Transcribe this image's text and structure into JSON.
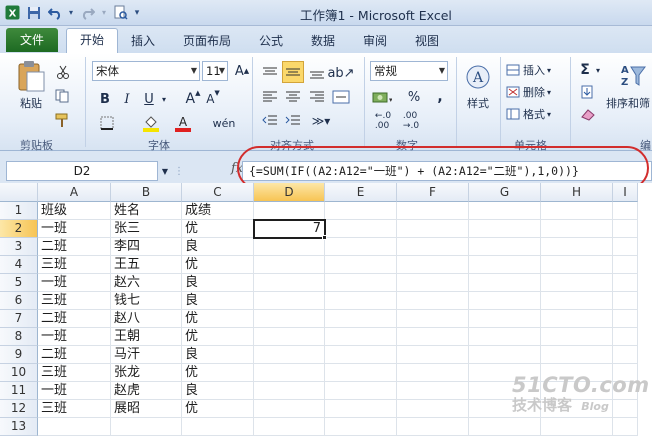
{
  "window": {
    "title": "工作簿1 - Microsoft Excel"
  },
  "qat": {
    "save_icon": "save-icon",
    "undo_icon": "undo-icon",
    "redo_icon": "redo-icon",
    "preview_icon": "print-preview-icon"
  },
  "tabs": [
    {
      "label": "文件"
    },
    {
      "label": "开始"
    },
    {
      "label": "插入"
    },
    {
      "label": "页面布局"
    },
    {
      "label": "公式"
    },
    {
      "label": "数据"
    },
    {
      "label": "审阅"
    },
    {
      "label": "视图"
    }
  ],
  "ribbon": {
    "clipboard": {
      "paste": "粘贴",
      "label": "剪贴板"
    },
    "font": {
      "name": "宋体",
      "size": "11",
      "label": "字体",
      "bold": "B",
      "italic": "I",
      "underline": "U"
    },
    "alignment": {
      "label": "对齐方式"
    },
    "number": {
      "format": "常规",
      "percent": "%",
      "comma": ",",
      "label": "数字"
    },
    "styles": {
      "label": "样式"
    },
    "cells": {
      "insert": "插入",
      "delete": "删除",
      "format": "格式",
      "label": "单元格"
    },
    "editing": {
      "sigma": "Σ",
      "sort": "排序和筛",
      "label": "编"
    }
  },
  "formula_bar": {
    "name_box": "D2",
    "fx": "fx",
    "formula": "{=SUM(IF((A2:A12=\"一班\") + (A2:A12=\"二班\"),1,0))}"
  },
  "sheet": {
    "columns": [
      "A",
      "B",
      "C",
      "D",
      "E",
      "F",
      "G",
      "H",
      "I"
    ],
    "rows": [
      "1",
      "2",
      "3",
      "4",
      "5",
      "6",
      "7",
      "8",
      "9",
      "10",
      "11",
      "12",
      "13"
    ],
    "cells": [
      [
        "班级",
        "姓名",
        "成绩",
        ""
      ],
      [
        "一班",
        "张三",
        "优",
        "7"
      ],
      [
        "二班",
        "李四",
        "良",
        ""
      ],
      [
        "三班",
        "王五",
        "优",
        ""
      ],
      [
        "一班",
        "赵六",
        "良",
        ""
      ],
      [
        "三班",
        "钱七",
        "良",
        ""
      ],
      [
        "二班",
        "赵八",
        "优",
        ""
      ],
      [
        "一班",
        "王朝",
        "优",
        ""
      ],
      [
        "二班",
        "马汗",
        "良",
        ""
      ],
      [
        "三班",
        "张龙",
        "优",
        ""
      ],
      [
        "一班",
        "赵虎",
        "良",
        ""
      ],
      [
        "三班",
        "展昭",
        "优",
        ""
      ],
      [
        "",
        "",
        "",
        ""
      ]
    ],
    "active_cell": "D2"
  },
  "watermark": {
    "line1": "51CTO.com",
    "line2": "技术博客",
    "line3": "Blog"
  }
}
